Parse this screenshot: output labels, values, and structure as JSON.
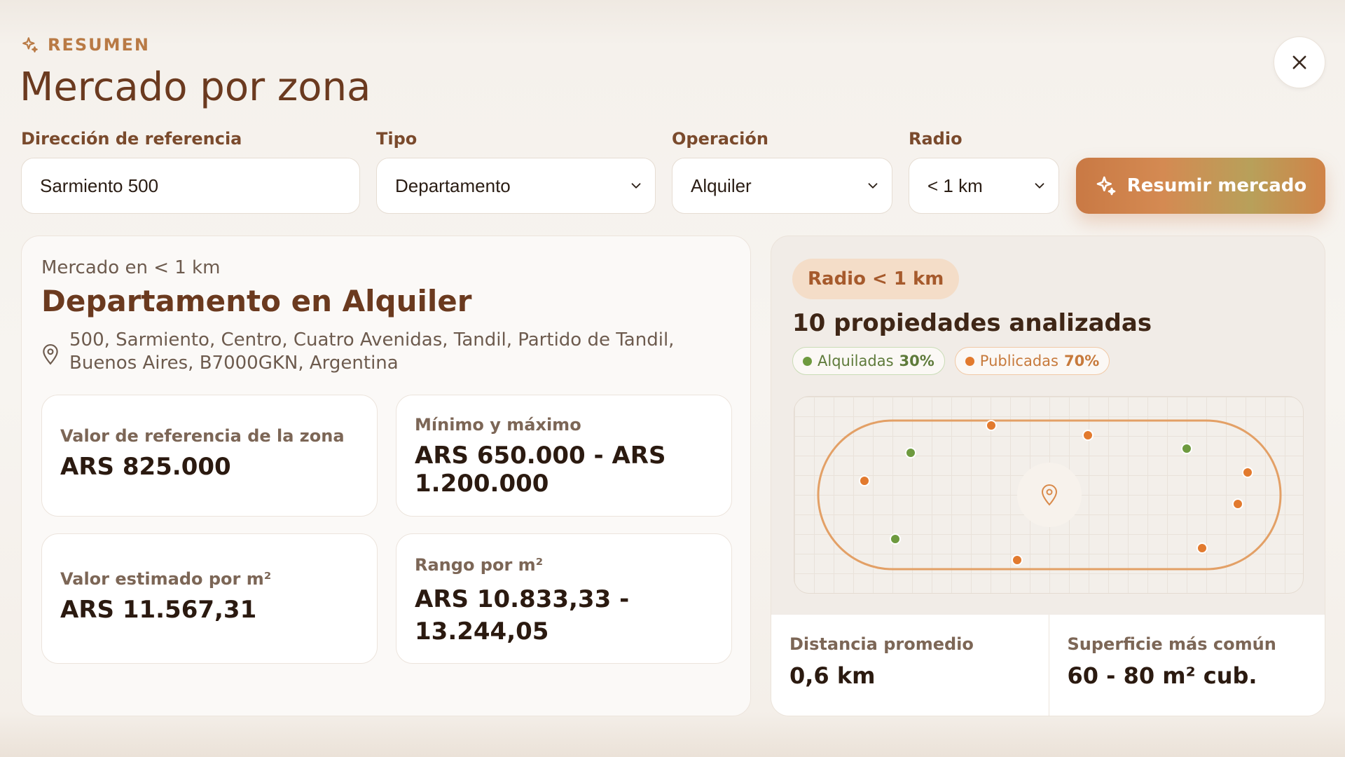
{
  "header": {
    "eyebrow": "RESUMEN",
    "title": "Mercado por zona",
    "close_icon": "close-icon"
  },
  "form": {
    "address": {
      "label": "Dirección de referencia",
      "value": "Sarmiento 500"
    },
    "type": {
      "label": "Tipo",
      "value": "Departamento"
    },
    "operation": {
      "label": "Operación",
      "value": "Alquiler"
    },
    "radius": {
      "label": "Radio",
      "value": "< 1 km"
    },
    "submit_label": "Resumir mercado"
  },
  "summary": {
    "subtitle": "Mercado en < 1 km",
    "title": "Departamento en Alquiler",
    "address": "500, Sarmiento, Centro, Cuatro Avenidas, Tandil, Partido de Tandil, Buenos Aires, B7000GKN, Argentina",
    "stats": [
      {
        "label": "Valor de referencia de la zona",
        "value": "ARS 825.000"
      },
      {
        "label": "Mínimo y máximo",
        "value": "ARS 650.000 - ARS 1.200.000"
      },
      {
        "label": "Valor estimado por m²",
        "value": "ARS 11.567,31"
      },
      {
        "label": "Rango por m²",
        "value": "ARS 10.833,33 - 13.244,05"
      }
    ]
  },
  "map_panel": {
    "radius_badge": "Radio < 1 km",
    "properties_title": "10 propiedades analizadas",
    "legend": [
      {
        "label": "Alquiladas",
        "percent": "30%",
        "color": "#6e9a3f"
      },
      {
        "label": "Publicadas",
        "percent": "70%",
        "color": "#e27a2e"
      }
    ],
    "bottom": [
      {
        "label": "Distancia promedio",
        "value": "0,6 km"
      },
      {
        "label": "Superficie más común",
        "value": "60 - 80 m² cub."
      }
    ]
  },
  "colors": {
    "accent": "#c97944",
    "rented": "#6e9a3f",
    "published": "#e27a2e",
    "title": "#6b3a1f"
  }
}
